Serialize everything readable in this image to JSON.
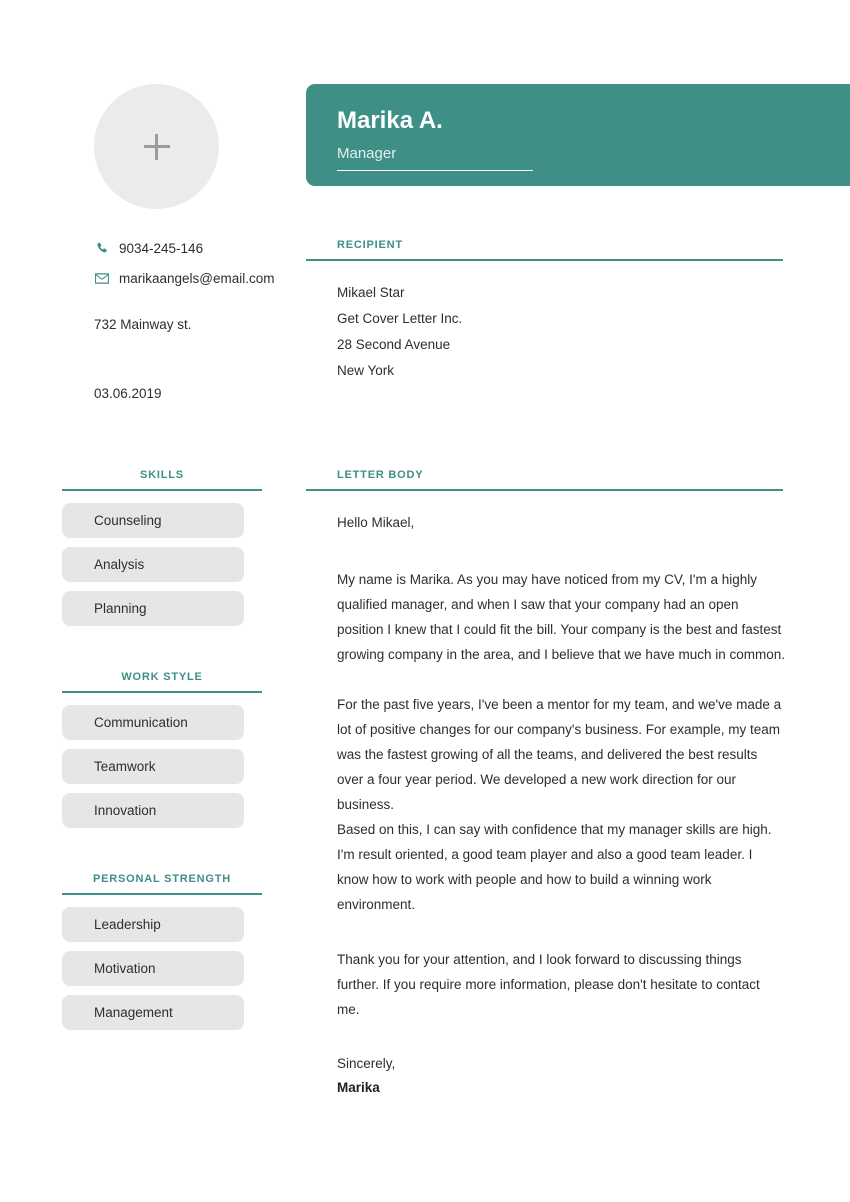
{
  "document": {
    "type": "cover-letter",
    "accent_color": "#3e8f86",
    "pill_color": "#e6e6e6",
    "text_color": "#2e2e2e"
  },
  "header": {
    "name": "Marika A.",
    "role": "Manager"
  },
  "avatar": {
    "icon": "plus-icon",
    "placeholder_hint": "+"
  },
  "contact": {
    "phone": {
      "icon": "phone-icon",
      "value": "9034-245-146"
    },
    "email": {
      "icon": "envelope-icon",
      "value": "marikaangels@email.com"
    },
    "address": "732 Mainway st.",
    "date": "03.06.2019"
  },
  "sidebar": {
    "sections": [
      {
        "heading": "SKILLS",
        "items": [
          "Counseling",
          "Analysis",
          "Planning"
        ]
      },
      {
        "heading": "WORK STYLE",
        "items": [
          "Communication",
          "Teamwork",
          "Innovation"
        ]
      },
      {
        "heading": "PERSONAL STRENGTH",
        "items": [
          "Leadership",
          "Motivation",
          "Management"
        ]
      }
    ]
  },
  "recipient": {
    "heading": "RECIPIENT",
    "lines": [
      "Mikael Star",
      "Get Cover Letter Inc.",
      "28 Second Avenue",
      "New York"
    ]
  },
  "letter": {
    "heading": "LETTER BODY",
    "salutation": "Hello Mikael,",
    "paragraphs": [
      "My name is Marika. As you may have noticed from my CV, I'm a highly qualified manager, and when I saw that your company had an open position I knew that I could fit the bill. Your company is the best and fastest growing company in the area, and I believe that we have much in common.",
      "For the past five years, I've been a mentor for my team, and we've made a lot of positive changes for our company's business. For example, my team was the fastest growing of all the teams, and delivered the best results over a four year period. We developed a new work direction for our business.",
      "Based on this, I can say with confidence that my manager skills are high. I'm result oriented, a good team player and also a good team leader. I know how to work with people and how to build a winning work environment.",
      "Thank you for your attention, and I look forward to discussing things further. If you require more information, please don't hesitate to contact me."
    ],
    "sign_off": "Sincerely,",
    "signature": "Marika"
  }
}
